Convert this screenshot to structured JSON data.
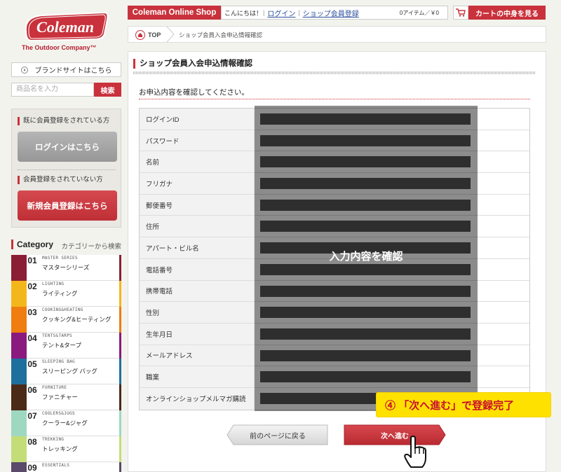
{
  "brand": {
    "logo_text": "Coleman",
    "tagline": "The Outdoor Company™",
    "accent": "#c9323c"
  },
  "header": {
    "shop_title": "Coleman Online Shop",
    "greeting": "こんにちは！",
    "login_link": "ログイン",
    "register_link": "ショップ会員登録",
    "cart_count": "0アイテム／￥0",
    "cart_button": "カートの中身を見る"
  },
  "breadcrumb": {
    "top": "TOP",
    "current": "ショップ会員入会申込情報確認"
  },
  "sidebar": {
    "brand_site": "ブランドサイトはこちら",
    "search_placeholder": "商品名を入力",
    "search_button": "検索",
    "member_heading": "既に会員登録をされている方",
    "login_button": "ログインはこちら",
    "nonmember_heading": "会員登録をされていない方",
    "register_button": "新規会員登録はこちら",
    "category_title": "Category",
    "category_sub": "カテゴリーから検索",
    "categories": [
      {
        "num": "01",
        "en": "MASTER SERIES",
        "jp": "マスターシリーズ",
        "color": "#8b1e35"
      },
      {
        "num": "02",
        "en": "LIGHTING",
        "jp": "ライティング",
        "color": "#f4b71b"
      },
      {
        "num": "03",
        "en": "COOKING&HEATING",
        "jp": "クッキング&ヒーティング",
        "color": "#ef7d0f"
      },
      {
        "num": "04",
        "en": "TENTS&TARPS",
        "jp": "テント&タープ",
        "color": "#8a1a7e"
      },
      {
        "num": "05",
        "en": "SLEEPING BAG",
        "jp": "スリーピング バッグ",
        "color": "#1f6f9e"
      },
      {
        "num": "06",
        "en": "FURNITURE",
        "jp": "ファニチャー",
        "color": "#4b2a18"
      },
      {
        "num": "07",
        "en": "COOLERS&JUGS",
        "jp": "クーラー&ジャグ",
        "color": "#9ed8c0"
      },
      {
        "num": "08",
        "en": "TREKKING",
        "jp": "トレッキング",
        "color": "#c5dd78"
      },
      {
        "num": "09",
        "en": "ESSENTIALS",
        "jp": "",
        "color": "#5b4a6a"
      }
    ]
  },
  "main": {
    "title": "ショップ会員入会申込情報確認",
    "intro": "お申込内容を確認してください。",
    "fields": [
      "ログインID",
      "パスワード",
      "名前",
      "フリガナ",
      "郵便番号",
      "住所",
      "アパート・ビル名",
      "電話番号",
      "携帯電話",
      "性別",
      "生年月日",
      "メールアドレス",
      "職業",
      "オンラインショップメルマガ購読"
    ],
    "overlay_text": "入力内容を確認",
    "back_button": "前のページに戻る",
    "next_button": "次へ進む",
    "callout": "④ 「次へ進む」で登録完了"
  }
}
